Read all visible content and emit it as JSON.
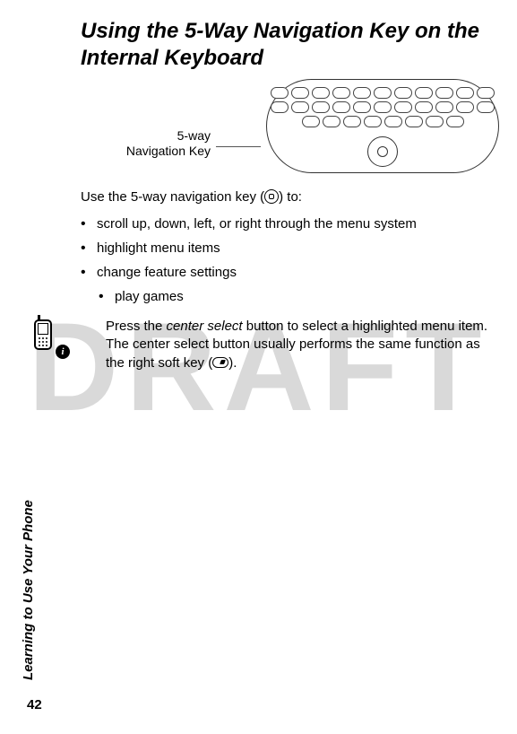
{
  "watermark": "DRAFT",
  "heading": "Using the 5-Way Navigation Key on the Internal Keyboard",
  "diagram_label_line1": "5-way",
  "diagram_label_line2": "Navigation Key",
  "intro_before": "Use the 5-way navigation key (",
  "intro_after": ") to:",
  "bullets": [
    "scroll up, down, left, or right through the menu system",
    "highlight menu items",
    "change feature settings",
    "play games"
  ],
  "tip_before": "Press the ",
  "tip_italic": "center select",
  "tip_mid": " button to select a highlighted menu item. The center select button usually performs the same function as the right soft key (",
  "tip_after": ").",
  "side_label": "Learning to Use Your Phone",
  "page_number": "42",
  "info_badge": "i"
}
